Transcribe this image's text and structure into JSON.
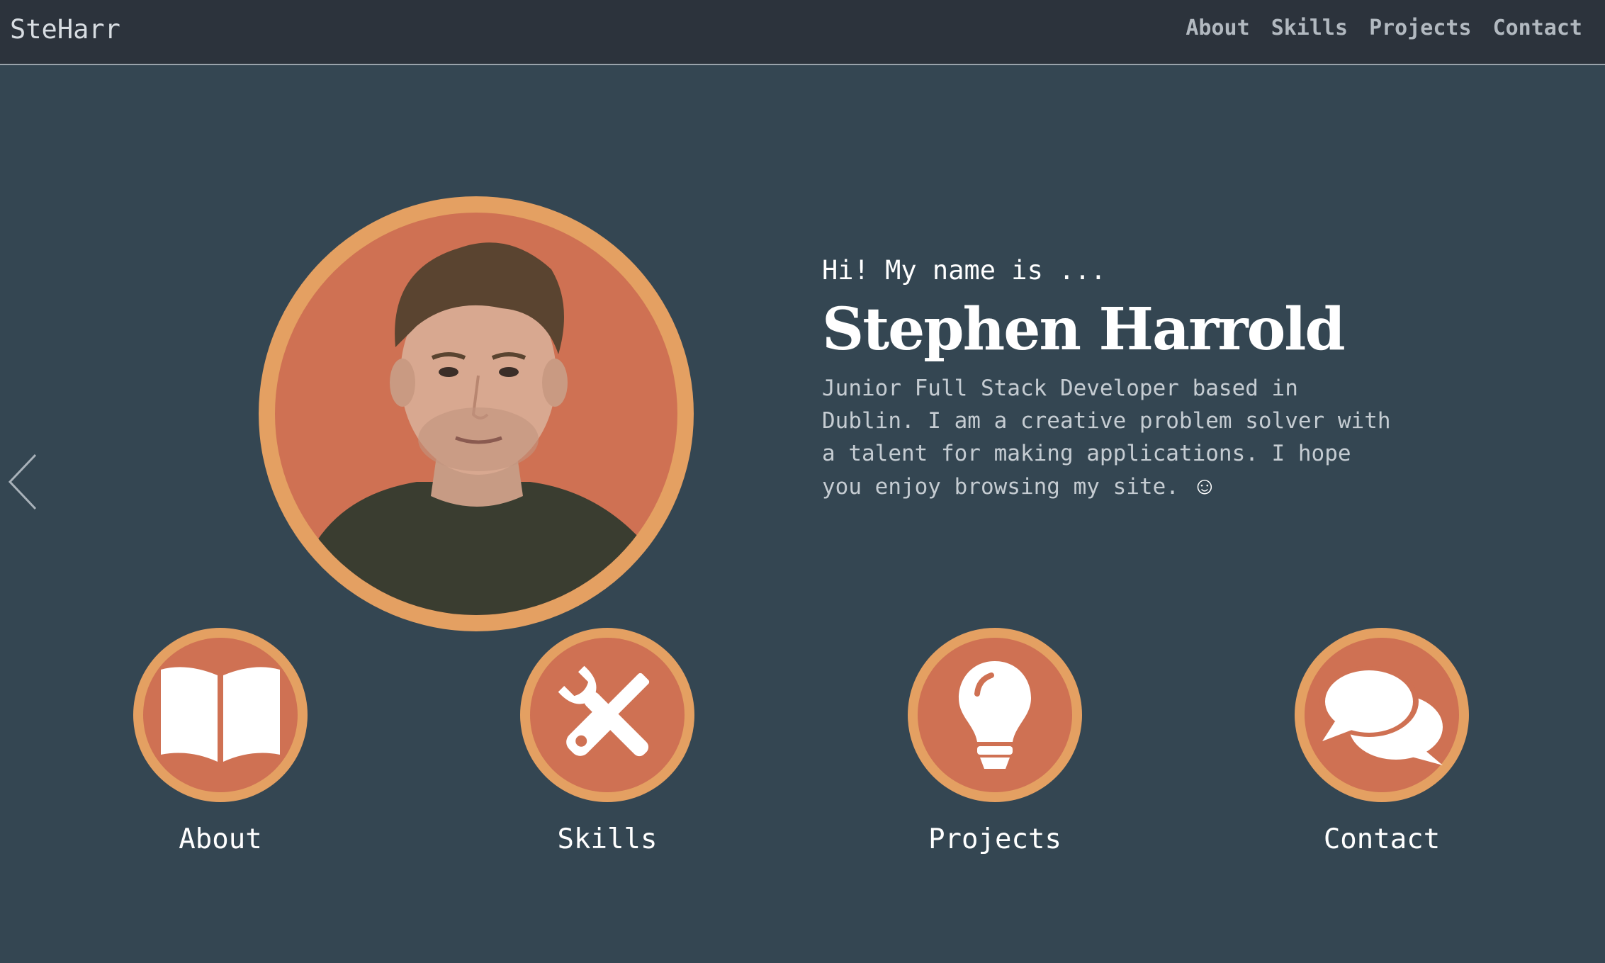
{
  "nav": {
    "brand": "SteHarr",
    "links": [
      "About",
      "Skills",
      "Projects",
      "Contact"
    ]
  },
  "hero": {
    "greeting": "Hi! My name is ...",
    "name": "Stephen Harrold",
    "bio": "Junior Full Stack Developer based in Dublin. I am a creative problem solver with a talent for making applications. I hope you enjoy browsing my site.",
    "smiley": "☺"
  },
  "features": [
    {
      "label": "About",
      "icon": "book-icon"
    },
    {
      "label": "Skills",
      "icon": "tools-icon"
    },
    {
      "label": "Projects",
      "icon": "lightbulb-icon"
    },
    {
      "label": "Contact",
      "icon": "chat-bubbles-icon"
    }
  ],
  "colors": {
    "background": "#344652",
    "navbar": "#2c333c",
    "accent_ring": "#e4a062",
    "accent_fill": "#cf7153"
  }
}
